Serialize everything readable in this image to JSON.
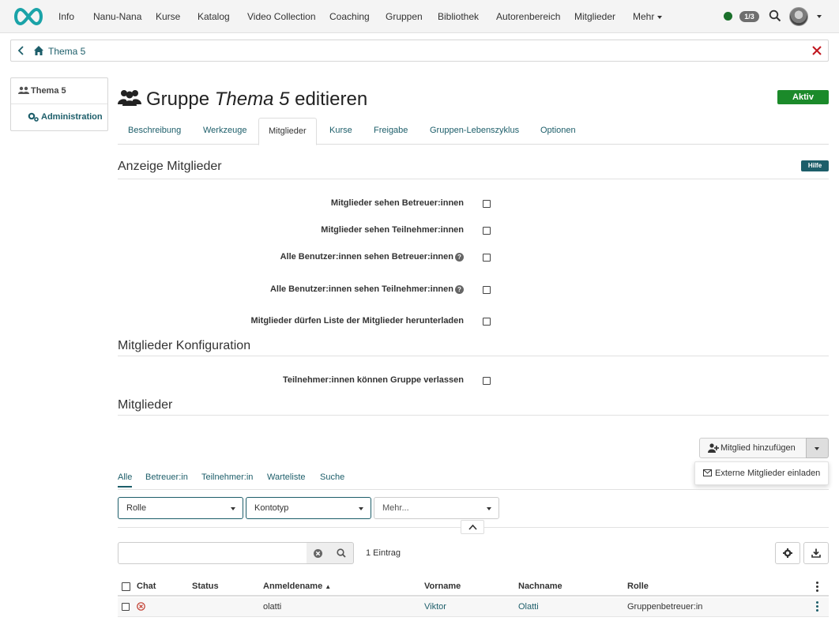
{
  "topnav": {
    "logo": "openolat-infinity-logo",
    "items": [
      "Info",
      "Nanu-Nana",
      "Kurse",
      "Katalog",
      "Video Collection",
      "Coaching",
      "Gruppen",
      "Bibliothek",
      "Autorenbereich",
      "Mitglieder",
      "Mehr"
    ],
    "online_count": "1/3",
    "colors": {
      "online": "#1a6f2a",
      "accent": "#1d5e6a"
    }
  },
  "breadcrumb": {
    "label": "Thema 5"
  },
  "sidemenu": {
    "top_label": "Thema 5",
    "sub_label": "Administration"
  },
  "page": {
    "title_prefix": "Gruppe ",
    "title_name": "Thema 5",
    "title_suffix": " editieren",
    "status": "Aktiv",
    "status_color": "#1b8a2a"
  },
  "tabs": [
    "Beschreibung",
    "Werkzeuge",
    "Mitglieder",
    "Kurse",
    "Freigabe",
    "Gruppen-Lebenszyklus",
    "Optionen"
  ],
  "active_tab": "Mitglieder",
  "display_section": {
    "title": "Anzeige Mitglieder",
    "help": "Hilfe",
    "options": [
      {
        "label": "Mitglieder sehen Betreuer:innen",
        "checked": false,
        "help": false
      },
      {
        "label": "Mitglieder sehen Teilnehmer:innen",
        "checked": false,
        "help": false
      },
      {
        "label": "Alle Benutzer:innen sehen Betreuer:innen",
        "checked": false,
        "help": true
      },
      {
        "label": "Alle Benutzer:innen sehen Teilnehmer:innen",
        "checked": false,
        "help": true
      },
      {
        "label": "Mitglieder dürfen Liste der Mitglieder herunterladen",
        "checked": false,
        "help": false
      }
    ]
  },
  "config_section": {
    "title": "Mitglieder Konfiguration",
    "options": [
      {
        "label": "Teilnehmer:innen können Gruppe verlassen",
        "checked": false
      }
    ]
  },
  "members": {
    "title": "Mitglieder",
    "add_button": "Mitglied hinzufügen",
    "dropdown_item": "Externe Mitglieder einladen",
    "filter_tabs": [
      "Alle",
      "Betreuer:in",
      "Teilnehmer:in",
      "Warteliste",
      "Suche"
    ],
    "active_filter": "Alle",
    "selects": [
      "Rolle",
      "Kontotyp",
      "Mehr..."
    ],
    "search_value": "",
    "count": "1 Eintrag",
    "columns": [
      "Chat",
      "Status",
      "Anmeldename",
      "Vorname",
      "Nachname",
      "Rolle"
    ],
    "sort_column": "Anmeldename",
    "rows": [
      {
        "chat": "offline-icon",
        "status": "",
        "login": "olatti",
        "firstname": "Viktor",
        "lastname": "Olatti",
        "role": "Gruppenbetreuer:in"
      }
    ]
  }
}
